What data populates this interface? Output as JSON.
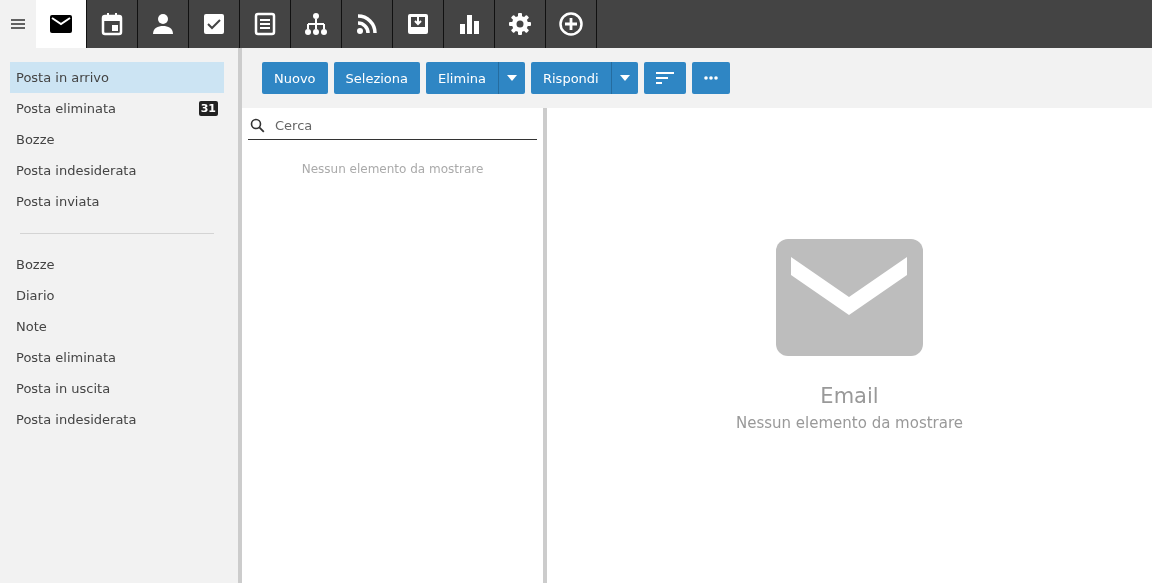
{
  "apps": [
    {
      "kind": "mail",
      "selected": true
    },
    {
      "kind": "calendar",
      "selected": false
    },
    {
      "kind": "person",
      "selected": false
    },
    {
      "kind": "tasks",
      "selected": false
    },
    {
      "kind": "notes",
      "selected": false
    },
    {
      "kind": "org",
      "selected": false
    },
    {
      "kind": "rss",
      "selected": false
    },
    {
      "kind": "inbox",
      "selected": false
    },
    {
      "kind": "chart",
      "selected": false
    },
    {
      "kind": "settings",
      "selected": false
    },
    {
      "kind": "add",
      "selected": false
    }
  ],
  "folders": [
    [
      {
        "label": "Posta in arrivo",
        "selected": true
      },
      {
        "label": "Posta eliminata",
        "selected": false,
        "count": "31"
      },
      {
        "label": "Bozze",
        "selected": false
      },
      {
        "label": "Posta indesiderata",
        "selected": false
      },
      {
        "label": "Posta inviata",
        "selected": false
      }
    ],
    [
      {
        "label": "Bozze",
        "selected": false
      },
      {
        "label": "Diario",
        "selected": false
      },
      {
        "label": "Note",
        "selected": false
      },
      {
        "label": "Posta eliminata",
        "selected": false
      },
      {
        "label": "Posta in uscita",
        "selected": false
      },
      {
        "label": "Posta indesiderata",
        "selected": false
      }
    ]
  ],
  "toolbar": [
    {
      "kind": "text",
      "label": "Nuovo"
    },
    {
      "kind": "text",
      "label": "Seleziona"
    },
    {
      "kind": "split",
      "label": "Elimina"
    },
    {
      "kind": "split",
      "label": "Rispondi"
    },
    {
      "kind": "sort"
    },
    {
      "kind": "more"
    }
  ],
  "search": {
    "placeholder": "Cerca"
  },
  "list_empty": "Nessun elemento da mostrare",
  "reading_pane": {
    "title": "Email",
    "message": "Nessun elemento da mostrare"
  }
}
